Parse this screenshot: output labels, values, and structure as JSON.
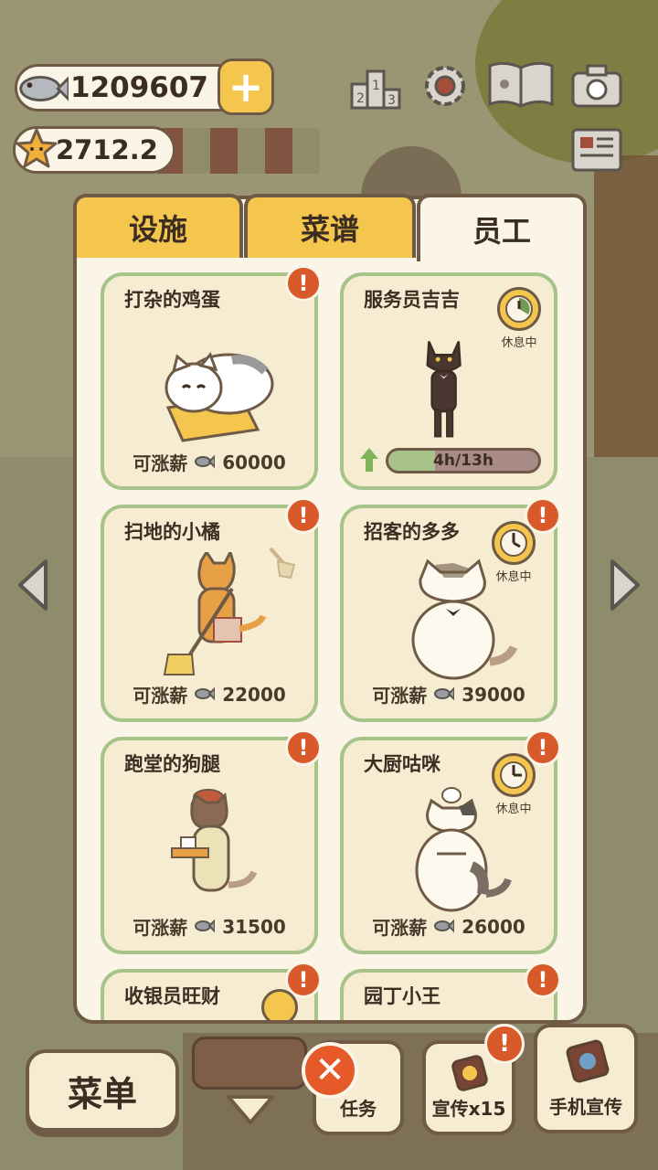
{
  "hud": {
    "fish_count": "1209607",
    "star_count": "2712.2",
    "icons": [
      "fish-icon",
      "star-icon",
      "plus-icon",
      "leaderboard-icon",
      "settings-gear-icon",
      "paw-book-icon",
      "camera-icon",
      "newspaper-icon"
    ]
  },
  "tabs": [
    {
      "label": "设施",
      "active": false
    },
    {
      "label": "菜谱",
      "active": false
    },
    {
      "label": "员工",
      "active": true
    }
  ],
  "staff": [
    {
      "name": "打杂的鸡蛋",
      "raise_label": "可涨薪",
      "raise_cost": "60000",
      "alert": "!"
    },
    {
      "name": "服务员吉吉",
      "status": "休息中",
      "progress_text": "4h/13h",
      "progress": 0.31
    },
    {
      "name": "扫地的小橘",
      "raise_label": "可涨薪",
      "raise_cost": "22000",
      "alert": "!"
    },
    {
      "name": "招客的多多",
      "status": "休息中",
      "raise_label": "可涨薪",
      "raise_cost": "39000",
      "alert": "!"
    },
    {
      "name": "跑堂的狗腿",
      "raise_label": "可涨薪",
      "raise_cost": "31500",
      "alert": "!"
    },
    {
      "name": "大厨咕咪",
      "status": "休息中",
      "raise_label": "可涨薪",
      "raise_cost": "26000",
      "alert": "!"
    },
    {
      "name": "收银员旺财",
      "alert": "!"
    },
    {
      "name": "园丁小王",
      "alert": "!"
    }
  ],
  "bottom": {
    "menu_label": "菜单",
    "close_symbol": "✕",
    "task_label": "任务",
    "promo_label": "宣传x15",
    "phone_promo_label": "手机宣传",
    "promo_alert": "!"
  },
  "colors": {
    "accent_yellow": "#f4c64e",
    "card_border_green": "#a8c389",
    "alert_orange": "#d8592a",
    "panel_cream": "#fbf5e8",
    "outline_brown": "#6f5a45"
  }
}
